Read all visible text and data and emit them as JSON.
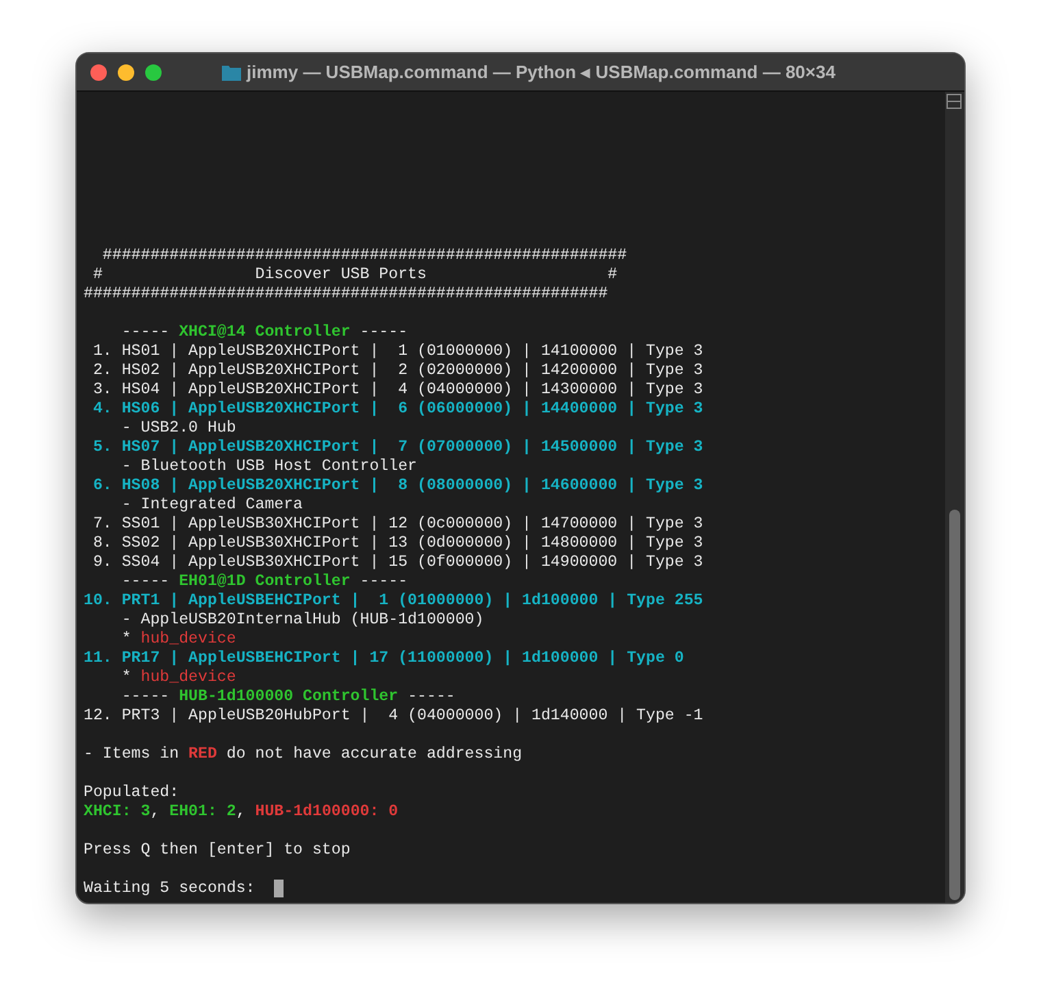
{
  "window": {
    "title": "jimmy — USBMap.command — Python ◂ USBMap.command — 80×34"
  },
  "terminal": {
    "lines": [
      {
        "spans": [
          {
            "text": "  #######################################################",
            "kind": "plain"
          }
        ]
      },
      {
        "spans": [
          {
            "text": " #                Discover USB Ports                   #",
            "kind": "plain"
          }
        ]
      },
      {
        "spans": [
          {
            "text": "#######################################################",
            "kind": "plain"
          }
        ]
      },
      {
        "kind": "blank"
      },
      {
        "spans": [
          {
            "text": "    ----- ",
            "kind": "plain"
          },
          {
            "text": "XHCI@14 Controller",
            "kind": "green"
          },
          {
            "text": " -----",
            "kind": "plain"
          }
        ]
      },
      {
        "spans": [
          {
            "text": " 1. HS01 | AppleUSB20XHCIPort |  1 (01000000) | 14100000 | Type 3",
            "kind": "plain"
          }
        ]
      },
      {
        "spans": [
          {
            "text": " 2. HS02 | AppleUSB20XHCIPort |  2 (02000000) | 14200000 | Type 3",
            "kind": "plain"
          }
        ]
      },
      {
        "spans": [
          {
            "text": " 3. HS04 | AppleUSB20XHCIPort |  4 (04000000) | 14300000 | Type 3",
            "kind": "plain"
          }
        ]
      },
      {
        "spans": [
          {
            "text": " 4. HS06 | AppleUSB20XHCIPort |  6 (06000000) | 14400000 | Type 3",
            "kind": "cyan"
          }
        ]
      },
      {
        "spans": [
          {
            "text": "    - USB2.0 Hub",
            "kind": "plain"
          }
        ]
      },
      {
        "spans": [
          {
            "text": " 5. HS07 | AppleUSB20XHCIPort |  7 (07000000) | 14500000 | Type 3",
            "kind": "cyan"
          }
        ]
      },
      {
        "spans": [
          {
            "text": "    - Bluetooth USB Host Controller",
            "kind": "plain"
          }
        ]
      },
      {
        "spans": [
          {
            "text": " 6. HS08 | AppleUSB20XHCIPort |  8 (08000000) | 14600000 | Type 3",
            "kind": "cyan"
          }
        ]
      },
      {
        "spans": [
          {
            "text": "    - Integrated Camera",
            "kind": "plain"
          }
        ]
      },
      {
        "spans": [
          {
            "text": " 7. SS01 | AppleUSB30XHCIPort | 12 (0c000000) | 14700000 | Type 3",
            "kind": "plain"
          }
        ]
      },
      {
        "spans": [
          {
            "text": " 8. SS02 | AppleUSB30XHCIPort | 13 (0d000000) | 14800000 | Type 3",
            "kind": "plain"
          }
        ]
      },
      {
        "spans": [
          {
            "text": " 9. SS04 | AppleUSB30XHCIPort | 15 (0f000000) | 14900000 | Type 3",
            "kind": "plain"
          }
        ]
      },
      {
        "spans": [
          {
            "text": "    ----- ",
            "kind": "plain"
          },
          {
            "text": "EH01@1D Controller",
            "kind": "green"
          },
          {
            "text": " -----",
            "kind": "plain"
          }
        ]
      },
      {
        "spans": [
          {
            "text": "10. PRT1 | AppleUSBEHCIPort |  1 (01000000) | 1d100000 | Type 255",
            "kind": "cyan"
          }
        ]
      },
      {
        "spans": [
          {
            "text": "    - AppleUSB20InternalHub (HUB-1d100000)",
            "kind": "plain"
          }
        ]
      },
      {
        "spans": [
          {
            "text": "    * ",
            "kind": "plain"
          },
          {
            "text": "hub_device",
            "kind": "red"
          }
        ]
      },
      {
        "spans": [
          {
            "text": "11. PR17 | AppleUSBEHCIPort | 17 (11000000) | 1d100000 | Type 0",
            "kind": "cyan"
          }
        ]
      },
      {
        "spans": [
          {
            "text": "    * ",
            "kind": "plain"
          },
          {
            "text": "hub_device",
            "kind": "red"
          }
        ]
      },
      {
        "spans": [
          {
            "text": "    ----- ",
            "kind": "plain"
          },
          {
            "text": "HUB-1d100000 Controller",
            "kind": "green"
          },
          {
            "text": " -----",
            "kind": "plain"
          }
        ]
      },
      {
        "spans": [
          {
            "text": "12. PRT3 | AppleUSB20HubPort |  4 (04000000) | 1d140000 | Type -1",
            "kind": "plain"
          }
        ]
      },
      {
        "kind": "blank"
      },
      {
        "spans": [
          {
            "text": "- Items in ",
            "kind": "plain"
          },
          {
            "text": "RED",
            "kind": "redbold"
          },
          {
            "text": " do not have accurate addressing",
            "kind": "plain"
          }
        ]
      },
      {
        "kind": "blank"
      },
      {
        "spans": [
          {
            "text": "Populated:",
            "kind": "plain"
          }
        ]
      },
      {
        "spans": [
          {
            "text": "XHCI: 3",
            "kind": "green"
          },
          {
            "text": ", ",
            "kind": "plain"
          },
          {
            "text": "EH01: 2",
            "kind": "green"
          },
          {
            "text": ", ",
            "kind": "plain"
          },
          {
            "text": "HUB-1d100000: 0",
            "kind": "redbold"
          }
        ]
      },
      {
        "kind": "blank"
      },
      {
        "spans": [
          {
            "text": "Press Q then [enter] to stop",
            "kind": "plain"
          }
        ]
      },
      {
        "kind": "blank"
      },
      {
        "spans": [
          {
            "text": "Waiting 5 seconds:  ",
            "kind": "plain"
          }
        ],
        "cursor": true
      }
    ]
  }
}
